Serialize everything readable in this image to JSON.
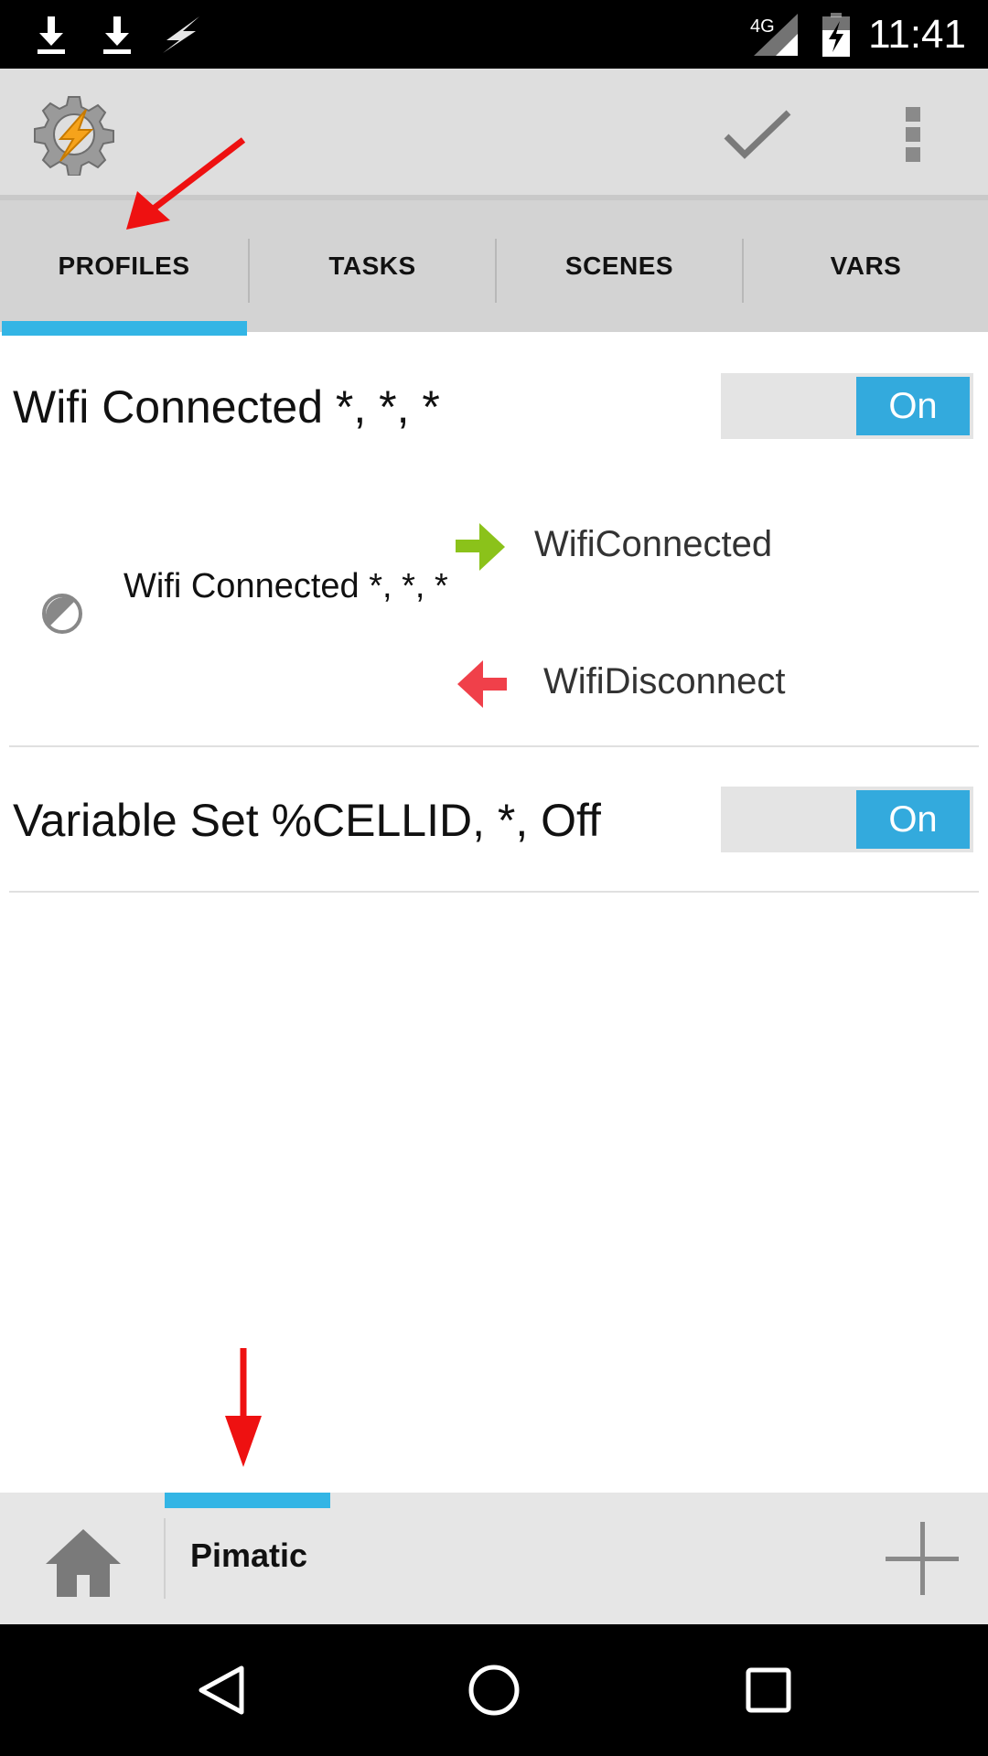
{
  "status_bar": {
    "clock": "11:41",
    "network": "4G",
    "icons": [
      "download-icon",
      "download-icon",
      "flash-icon",
      "signal-icon",
      "battery-charging-icon"
    ]
  },
  "action_bar": {
    "logo_icon": "tasker-gear-icon",
    "confirm_icon": "checkmark-icon",
    "menu_icon": "overflow-menu-icon"
  },
  "tabs": [
    {
      "label": "PROFILES",
      "selected": true
    },
    {
      "label": "TASKS",
      "selected": false
    },
    {
      "label": "SCENES",
      "selected": false
    },
    {
      "label": "VARS",
      "selected": false
    }
  ],
  "profiles": [
    {
      "title": "Wifi Connected *, *, *",
      "toggle": "On",
      "expanded": true,
      "context": "Wifi Connected *, *, *",
      "enter_task": "WifiConnected",
      "exit_task": "WifiDisconnect"
    },
    {
      "title": "Variable Set %CELLID, *, Off",
      "toggle": "On",
      "expanded": false
    }
  ],
  "project_bar": {
    "home_icon": "home-icon",
    "project_name": "Pimatic",
    "add_icon": "plus-icon"
  },
  "colors": {
    "accent": "#33b5e5",
    "toggle_on": "#33aadd",
    "enter_arrow": "#8bc21a",
    "exit_arrow": "#f0404a",
    "annotation": "#ee1111"
  },
  "nav_bar": {
    "icons": [
      "back-icon",
      "home-circle-icon",
      "recents-icon"
    ]
  }
}
